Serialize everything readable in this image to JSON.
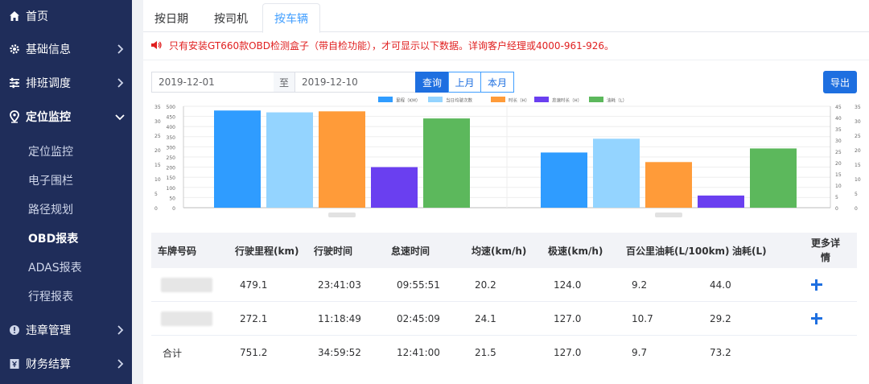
{
  "sidebar": {
    "items": [
      {
        "label": "首页",
        "icon": "home-icon"
      },
      {
        "label": "基础信息",
        "icon": "gear-icon"
      },
      {
        "label": "排班调度",
        "icon": "sliders-icon"
      },
      {
        "label": "定位监控",
        "icon": "location-pin-icon"
      },
      {
        "label": "违章管理",
        "icon": "warning-icon"
      },
      {
        "label": "财务结算",
        "icon": "finance-icon"
      }
    ],
    "subitems": [
      {
        "label": "定位监控"
      },
      {
        "label": "电子围栏"
      },
      {
        "label": "路径规划"
      },
      {
        "label": "OBD报表"
      },
      {
        "label": "ADAS报表"
      },
      {
        "label": "行程报表"
      }
    ]
  },
  "tabs": [
    {
      "label": "按日期"
    },
    {
      "label": "按司机"
    },
    {
      "label": "按车辆"
    }
  ],
  "notice": "只有安装GT660款OBD检测盒子（带自检功能），才可显示以下数据。详询客户经理或4000-961-926。",
  "filter": {
    "start_date": "2019-12-01",
    "separator": "至",
    "end_date": "2019-12-10",
    "query_label": "查询",
    "last_month_label": "上月",
    "this_month_label": "本月",
    "export_label": "导出"
  },
  "colors": {
    "sidebar_bg": "#1f2d5a",
    "primary": "#1e6fe0",
    "notice_red": "#e02020"
  },
  "chart_data": {
    "type": "bar",
    "categories": [
      "",
      ""
    ],
    "series": [
      {
        "name": "里程（KM）",
        "color": "#2f9cff",
        "axis": "left",
        "values": [
          479.1,
          272.1
        ]
      },
      {
        "name": "当日均驶次数",
        "color": "#94d4ff",
        "axis": "left",
        "values": [
          470,
          340
        ]
      },
      {
        "name": "时长（H）",
        "color": "#ff9b39",
        "axis": "left",
        "values": [
          475,
          225
        ]
      },
      {
        "name": "怠速时长（H）",
        "color": "#6a3ff0",
        "axis": "left",
        "values": [
          200,
          60
        ]
      },
      {
        "name": "油耗（L）",
        "color": "#5cb85c",
        "axis": "right",
        "values": [
          44.0,
          29.2
        ]
      }
    ],
    "left_axis_outer_ticks": [
      "0",
      "5",
      "10",
      "15",
      "20",
      "25",
      "30",
      "35"
    ],
    "left_axis_inner_ticks": [
      "0",
      "50",
      "100",
      "150",
      "200",
      "250",
      "300",
      "350",
      "400",
      "450",
      "500"
    ],
    "right_axis_inner_ticks": [
      "0",
      "5",
      "10",
      "15",
      "20",
      "25",
      "30",
      "35",
      "40",
      "45"
    ],
    "right_axis_outer_ticks": [
      "0",
      "5",
      "10",
      "15",
      "20",
      "25",
      "30",
      "35"
    ],
    "ylim_left": [
      0,
      500
    ],
    "ylim_right": [
      0,
      50
    ],
    "legend_position": "top"
  },
  "table": {
    "headers": [
      "车牌号码",
      "行驶里程(km)",
      "行驶时间",
      "怠速时间",
      "均速(km/h)",
      "极速(km/h)",
      "百公里油耗(L/100km)",
      "油耗(L)",
      "更多详情"
    ],
    "rows": [
      {
        "plate": "",
        "mileage": "479.1",
        "drive_time": "23:41:03",
        "idle_time": "09:55:51",
        "avg_speed": "20.2",
        "max_speed": "124.0",
        "fuel_per_100": "9.2",
        "fuel": "44.0"
      },
      {
        "plate": "",
        "mileage": "272.1",
        "drive_time": "11:18:49",
        "idle_time": "02:45:09",
        "avg_speed": "24.1",
        "max_speed": "127.0",
        "fuel_per_100": "10.7",
        "fuel": "29.2"
      }
    ],
    "total": {
      "label": "合计",
      "mileage": "751.2",
      "drive_time": "34:59:52",
      "idle_time": "12:41:00",
      "avg_speed": "21.5",
      "max_speed": "127.0",
      "fuel_per_100": "9.7",
      "fuel": "73.2"
    }
  }
}
